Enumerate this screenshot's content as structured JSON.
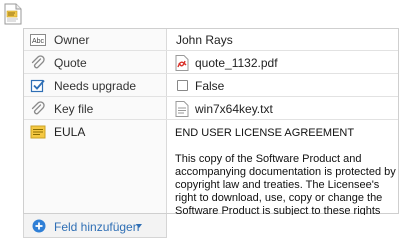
{
  "document_icon": "document-icon",
  "fields": [
    {
      "icon": "text-field-icon",
      "label": "Owner",
      "value": "John Rays"
    },
    {
      "icon": "paperclip-icon",
      "label": "Quote",
      "value_icon": "pdf-file-icon",
      "value": "quote_1132.pdf"
    },
    {
      "icon": "checkbox-field-icon",
      "label": "Needs upgrade",
      "value": "False"
    },
    {
      "icon": "paperclip-icon",
      "label": "Key file",
      "value_icon": "text-file-icon",
      "value": "win7x64key.txt"
    },
    {
      "icon": "notes-icon",
      "label": "EULA",
      "value_lines": [
        "END USER LICENSE AGREEMENT",
        "This copy of the Software Product and accompanying documentation is protected by copyright law and treaties. The Licensee's right to download, use, copy or change the Software Product is subject to these rights"
      ]
    }
  ],
  "add_field": {
    "icon": "plus-circle-icon",
    "label": "Feld hinzufügen"
  },
  "colors": {
    "accent": "#2f6fb5",
    "pdf": "#d9322b",
    "border": "#cfcfcf"
  }
}
